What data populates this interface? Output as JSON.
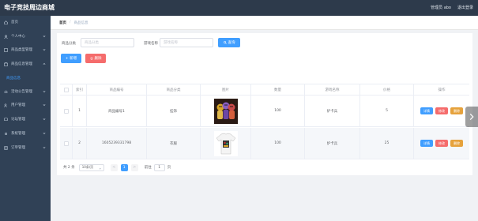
{
  "header": {
    "title": "电子竞技周边商城",
    "user": "管理员 abo",
    "logout": "退出登录"
  },
  "sidebar": {
    "items": [
      {
        "label": "首页",
        "icon": "home-icon"
      },
      {
        "label": "个人中心",
        "icon": "user-icon"
      },
      {
        "label": "商品类型管理",
        "icon": "list-icon"
      },
      {
        "label": "商品信息管理",
        "icon": "goods-icon"
      },
      {
        "label": "商品信息",
        "icon": ""
      },
      {
        "label": "活动公告管理",
        "icon": "notice-icon"
      },
      {
        "label": "用户管理",
        "icon": "users-icon"
      },
      {
        "label": "论坛管理",
        "icon": "forum-icon"
      },
      {
        "label": "系统管理",
        "icon": "settings-icon"
      },
      {
        "label": "订单管理",
        "icon": "order-icon"
      }
    ]
  },
  "breadcrumb": {
    "home": "首页",
    "separator": "/",
    "current": "商品信息"
  },
  "search": {
    "category_label": "商品分类",
    "category_placeholder": "商品分类",
    "name_label": "游戏名称",
    "name_placeholder": "游戏名称",
    "search_button": "查询"
  },
  "actions": {
    "add": "+ 新增",
    "delete": "删除"
  },
  "table": {
    "headers": [
      "索引",
      "商品编号",
      "商品分类",
      "图片",
      "数量",
      "游戏名称",
      "价格",
      "操作"
    ],
    "rows": [
      {
        "index": "1",
        "code": "商品编号1",
        "category": "挂饰",
        "image": "plush-toys",
        "quantity": "100",
        "game": "炉卡兵",
        "price": "5"
      },
      {
        "index": "2",
        "code": "1605239331798",
        "category": "衣服",
        "image": "tshirt",
        "quantity": "100",
        "game": "炉卡兵",
        "price": "25"
      }
    ],
    "op_detail": "详情",
    "op_edit": "修改",
    "op_delete": "删除"
  },
  "pagination": {
    "total": "共 2 条",
    "page_size": "10条/页",
    "prev": "<",
    "current": "1",
    "next": ">",
    "goto": "前往",
    "jump_value": "1",
    "page_unit": "页"
  },
  "colors": {
    "sidebar_bg": "#304156",
    "topbar_bg": "#2d3a4b",
    "primary": "#409eff",
    "danger": "#f56c6c",
    "warning": "#e6a23c"
  }
}
